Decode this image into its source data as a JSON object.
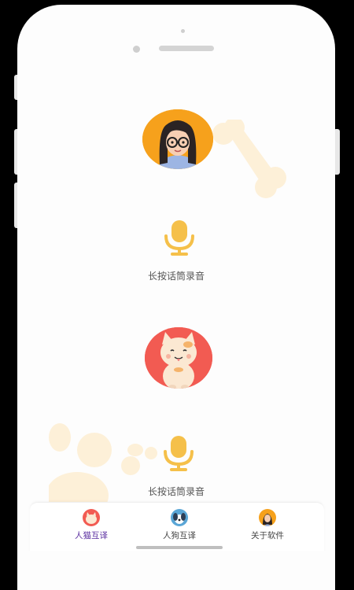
{
  "screen": {
    "user_avatar_icon": "girl-with-glasses-avatar",
    "cat_avatar_icon": "cat-avatar",
    "mic_icon": "microphone-icon",
    "record_labels": {
      "top": "长按话筒录音",
      "bottom": "长按话筒录音"
    },
    "colors": {
      "accent_yellow": "#f5c04a",
      "user_bg": "#f6a11c",
      "cat_bg": "#f25b52",
      "active_tab": "#5b2fa0",
      "deco": "#fdf0d8"
    }
  },
  "tabbar": {
    "tabs": [
      {
        "label": "人猫互译",
        "icon": "cat-tab-icon",
        "active": true
      },
      {
        "label": "人狗互译",
        "icon": "dog-tab-icon",
        "active": false
      },
      {
        "label": "关于软件",
        "icon": "user-tab-icon",
        "active": false
      }
    ]
  }
}
